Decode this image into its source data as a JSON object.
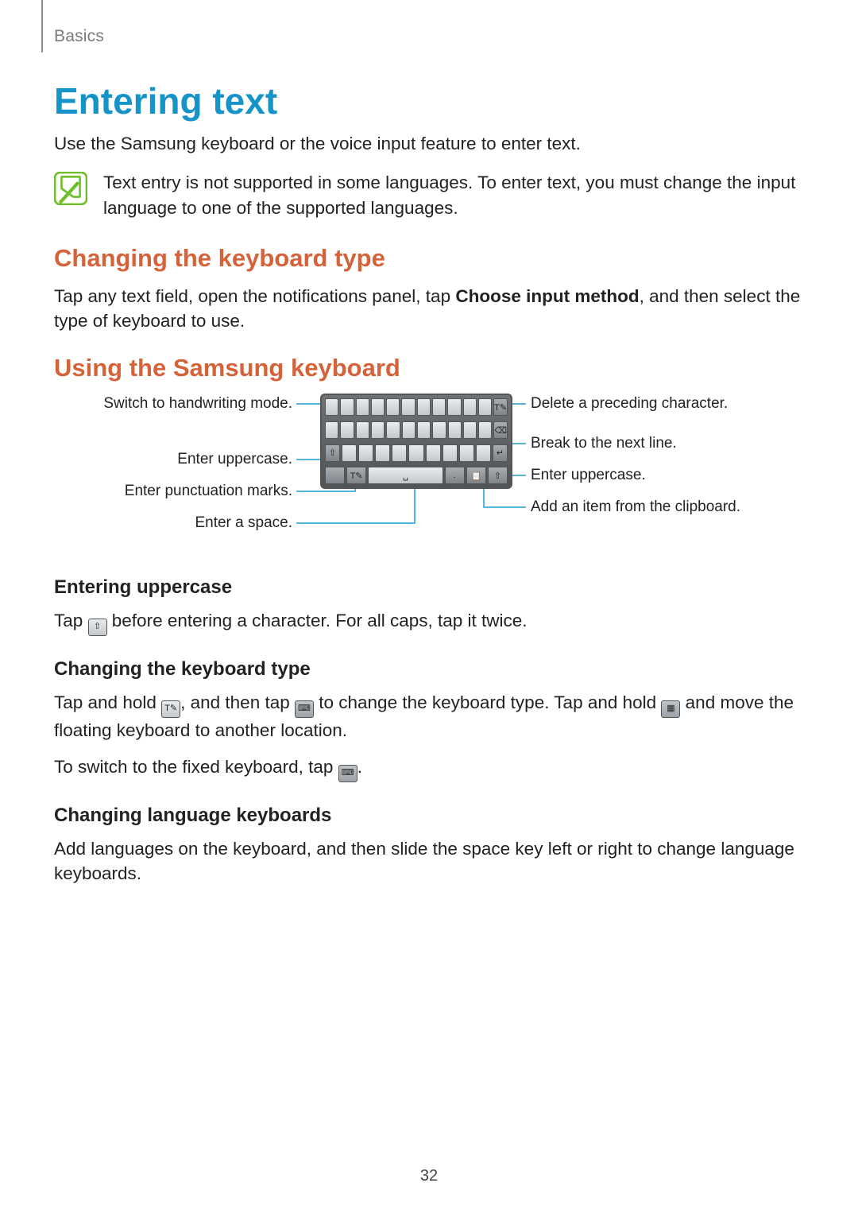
{
  "chapter": "Basics",
  "page_number": "32",
  "h1": "Entering text",
  "intro": "Use the Samsung keyboard or the voice input feature to enter text.",
  "note": "Text entry is not supported in some languages. To enter text, you must change the input language to one of the supported languages.",
  "h2a": "Changing the keyboard type",
  "para_a_pre": "Tap any text field, open the notifications panel, tap ",
  "para_a_bold": "Choose input method",
  "para_a_post": ", and then select the type of keyboard to use.",
  "h2b": "Using the Samsung keyboard",
  "labels_left": {
    "handwriting": "Switch to handwriting mode.",
    "shift": "Enter uppercase.",
    "punct": "Enter punctuation marks.",
    "space": "Enter a space."
  },
  "labels_right": {
    "delete": "Delete a preceding character.",
    "enter": "Break to the next line.",
    "shift2": "Enter uppercase.",
    "clip": "Add an item from the clipboard."
  },
  "h3a": "Entering uppercase",
  "p3a_pre": "Tap ",
  "p3a_post": " before entering a character. For all caps, tap it twice.",
  "h3b": "Changing the keyboard type",
  "p3b_1_a": "Tap and hold ",
  "p3b_1_b": ", and then tap ",
  "p3b_1_c": " to change the keyboard type. Tap and hold ",
  "p3b_1_d": " and move the floating keyboard to another location.",
  "p3b_2_a": "To switch to the fixed keyboard, tap ",
  "p3b_2_b": ".",
  "h3c": "Changing language keyboards",
  "p3c": "Add languages on the keyboard, and then slide the space key left or right to change language keyboards."
}
